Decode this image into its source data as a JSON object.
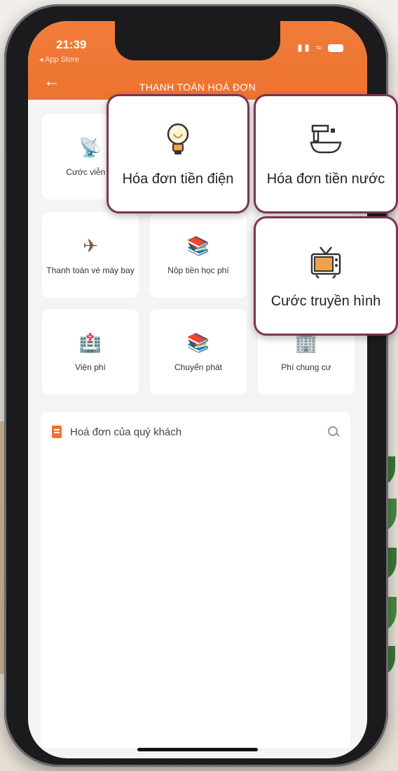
{
  "status_bar": {
    "time": "21:39",
    "back_app": "◂ App Store",
    "icons": "▮▮ ≈"
  },
  "header": {
    "title": "THANH TOÁN HOÁ ĐƠN",
    "back_glyph": "←"
  },
  "tiles": [
    {
      "label": "Cước viễn th",
      "icon": "tower-icon",
      "glyph": "📡"
    },
    {
      "label": "",
      "icon": "",
      "glyph": ""
    },
    {
      "label": "",
      "icon": "",
      "glyph": ""
    },
    {
      "label": "Thanh toán vé máy bay",
      "icon": "airplane-icon",
      "glyph": "✈"
    },
    {
      "label": "Nộp tiền học phí",
      "icon": "books-icon",
      "glyph": "📚"
    },
    {
      "label": "",
      "icon": "",
      "glyph": ""
    },
    {
      "label": "Viện phí",
      "icon": "hospital-icon",
      "glyph": "🏥"
    },
    {
      "label": "Chuyển phát",
      "icon": "books-icon",
      "glyph": "📚"
    },
    {
      "label": "Phí chung cư",
      "icon": "building-icon",
      "glyph": "🏢"
    }
  ],
  "invoice": {
    "title": "Hoá đơn của quý khách"
  },
  "callouts": {
    "electricity": "Hóa đơn tiền điện",
    "water": "Hóa đơn tiền nước",
    "tv": "Cước truyền hình"
  },
  "colors": {
    "brand": "#ee7330",
    "callout_border": "#7a3550"
  }
}
